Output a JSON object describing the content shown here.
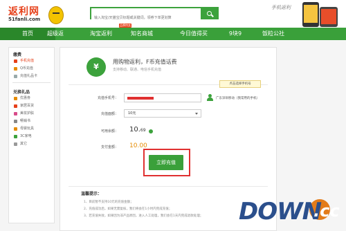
{
  "header": {
    "brand": "返利网",
    "domain": "51fanli.com",
    "search_placeholder": "输入淘宝/天猫宝贝标题或关键词，领券下单更划算",
    "promo_text": "手机返利"
  },
  "nav": {
    "items": [
      {
        "label": "首页"
      },
      {
        "label": "超级返"
      },
      {
        "label": "淘宝返利",
        "badge": "品牌特卖"
      },
      {
        "label": "知名商城"
      },
      {
        "label": "今日值得买"
      },
      {
        "label": "9块9"
      },
      {
        "label": "饭粒公社"
      }
    ],
    "active_index": 0
  },
  "sidebar": {
    "section1_title": "缴费",
    "section1_items": [
      {
        "label": "手机充值",
        "active": true,
        "icon": "phone-icon"
      },
      {
        "label": "Q币充值",
        "active": false,
        "icon": "qq-icon"
      },
      {
        "label": "充值礼品卡",
        "active": false,
        "icon": "card-icon"
      }
    ],
    "section2_title": "兑换礼品",
    "section2_items": [
      {
        "label": "优惠劵",
        "icon": "coupon-icon"
      },
      {
        "label": "家居百货",
        "icon": "home-icon"
      },
      {
        "label": "美妆护肤",
        "icon": "beauty-icon"
      },
      {
        "label": "畅销书",
        "icon": "book-icon"
      },
      {
        "label": "母婴玩具",
        "icon": "baby-icon"
      },
      {
        "label": "3C家电",
        "icon": "electronics-icon"
      },
      {
        "label": "其它",
        "icon": "other-icon"
      }
    ]
  },
  "main": {
    "banner_icon": "¥",
    "banner_title": "用购物返利，F币充值话费",
    "banner_subtitle": "支持移动、联通、电信手机充值",
    "tooltip": "点击选择手机号",
    "phone_label": "充值手机号：",
    "carrier": "广东深圳移动（我常用的手机）",
    "amount_label": "充值面额：",
    "amount_value": "10元",
    "balance_label": "可用余额：",
    "balance_int": "10.",
    "balance_dec": "69",
    "pay_label": "支付金额：",
    "pay_value": "10.00",
    "submit_label": "立即充值",
    "tips_title": "温馨提示：",
    "tips": [
      "1、目前暂不支持10元的充值金额；",
      "2、充值成功后，如果无需复核，我们将会在1小时内完成充值；",
      "3、若充值失败，如果因为非产品原因，进入人工处理，我们会在1天内完成退款处理；"
    ]
  },
  "watermark": {
    "text": "DOWN",
    "suffix": ".cc"
  },
  "colors": {
    "nav_green": "#3aa03a",
    "accent_red": "#e03030",
    "brand_orange": "#e6401a",
    "pay_orange": "#e58b00"
  }
}
